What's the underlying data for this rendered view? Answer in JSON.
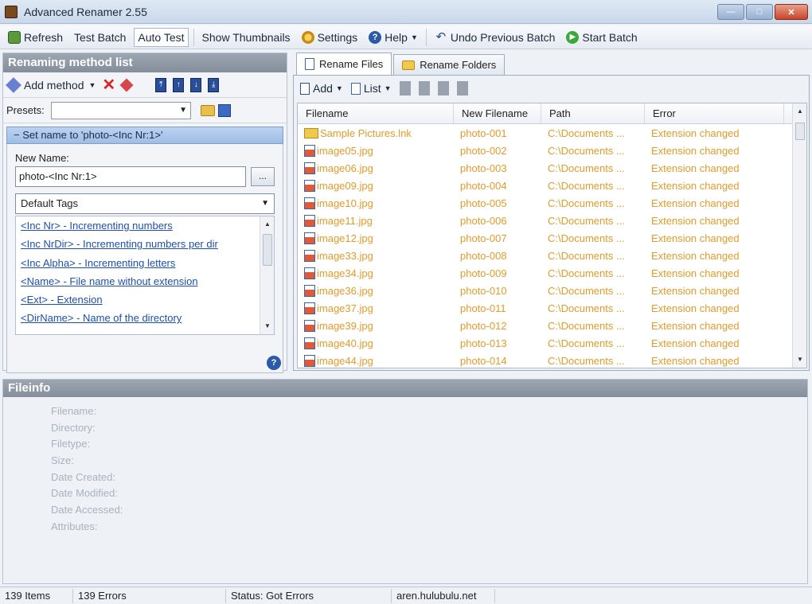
{
  "window": {
    "title": "Advanced Renamer 2.55",
    "min_symbol": "—",
    "max_symbol": "□",
    "close_symbol": "✕"
  },
  "toolbar": {
    "refresh": "Refresh",
    "test_batch": "Test Batch",
    "auto_test": "Auto Test",
    "show_thumbnails": "Show Thumbnails",
    "settings": "Settings",
    "help": "Help",
    "undo": "Undo Previous Batch",
    "start": "Start Batch"
  },
  "left_panel": {
    "title": "Renaming method list",
    "add_method": "Add method",
    "presets_label": "Presets:",
    "presets_value": "",
    "method_header": "− Set name to 'photo-<Inc Nr:1>'",
    "new_name_label": "New Name:",
    "new_name_value": "photo-<Inc Nr:1>",
    "browse_label": "...",
    "tags_combo": "Default Tags",
    "tags": [
      "<Inc Nr> - Incrementing numbers",
      "<Inc NrDir> - Incrementing numbers per dir",
      "<Inc Alpha> - Incrementing letters",
      "<Name> - File name without extension",
      "<Ext> - Extension",
      "<DirName> - Name of the directory"
    ],
    "help_symbol": "?"
  },
  "right_panel": {
    "tabs": [
      "Rename Files",
      "Rename Folders"
    ],
    "add_label": "Add",
    "list_label": "List",
    "columns": [
      "Filename",
      "New Filename",
      "Path",
      "Error"
    ],
    "rows": [
      {
        "icon": "folder",
        "filename": "Sample Pictures.lnk",
        "new": "photo-001",
        "path": "C:\\Documents ...",
        "error": "Extension changed"
      },
      {
        "icon": "image",
        "filename": "image05.jpg",
        "new": "photo-002",
        "path": "C:\\Documents ...",
        "error": "Extension changed"
      },
      {
        "icon": "image",
        "filename": "image06.jpg",
        "new": "photo-003",
        "path": "C:\\Documents ...",
        "error": "Extension changed"
      },
      {
        "icon": "image",
        "filename": "image09.jpg",
        "new": "photo-004",
        "path": "C:\\Documents ...",
        "error": "Extension changed"
      },
      {
        "icon": "image",
        "filename": "image10.jpg",
        "new": "photo-005",
        "path": "C:\\Documents ...",
        "error": "Extension changed"
      },
      {
        "icon": "image",
        "filename": "image11.jpg",
        "new": "photo-006",
        "path": "C:\\Documents ...",
        "error": "Extension changed"
      },
      {
        "icon": "image",
        "filename": "image12.jpg",
        "new": "photo-007",
        "path": "C:\\Documents ...",
        "error": "Extension changed"
      },
      {
        "icon": "image",
        "filename": "image33.jpg",
        "new": "photo-008",
        "path": "C:\\Documents ...",
        "error": "Extension changed"
      },
      {
        "icon": "image",
        "filename": "image34.jpg",
        "new": "photo-009",
        "path": "C:\\Documents ...",
        "error": "Extension changed"
      },
      {
        "icon": "image",
        "filename": "image36.jpg",
        "new": "photo-010",
        "path": "C:\\Documents ...",
        "error": "Extension changed"
      },
      {
        "icon": "image",
        "filename": "image37.jpg",
        "new": "photo-011",
        "path": "C:\\Documents ...",
        "error": "Extension changed"
      },
      {
        "icon": "image",
        "filename": "image39.jpg",
        "new": "photo-012",
        "path": "C:\\Documents ...",
        "error": "Extension changed"
      },
      {
        "icon": "image",
        "filename": "image40.jpg",
        "new": "photo-013",
        "path": "C:\\Documents ...",
        "error": "Extension changed"
      },
      {
        "icon": "image",
        "filename": "image44.jpg",
        "new": "photo-014",
        "path": "C:\\Documents ...",
        "error": "Extension changed"
      }
    ]
  },
  "fileinfo": {
    "title": "Fileinfo",
    "labels": [
      "Filename:",
      "Directory:",
      "Filetype:",
      "Size:",
      "Date Created:",
      "Date Modified:",
      "Date Accessed:",
      "Attributes:"
    ]
  },
  "status": {
    "items": "139 Items",
    "errors": "139 Errors",
    "status": "Status: Got Errors",
    "site": "aren.hulubulu.net"
  },
  "colors": {
    "error_row_text": "#e99a2a",
    "link_text": "#1d4fb6",
    "panel_title_bg": "#8f99a5"
  }
}
